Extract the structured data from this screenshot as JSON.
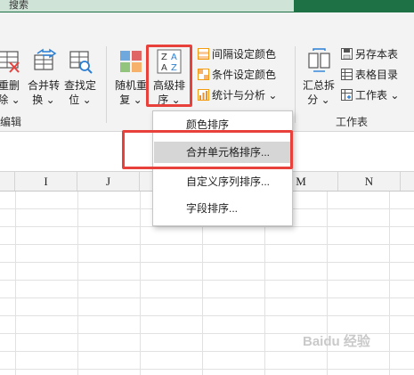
{
  "title_bar": {
    "search_text": "搜索"
  },
  "ribbon": {
    "edit_group": {
      "label": "编辑",
      "buttons": [
        {
          "label_line1": "重删",
          "label_line2": "除 ⌄"
        },
        {
          "label_line1": "合并转",
          "label_line2": "换 ⌄"
        },
        {
          "label_line1": "查找定",
          "label_line2": "位 ⌄"
        }
      ]
    },
    "sort_group": {
      "random_button": {
        "label_line1": "随机重",
        "label_line2": "复 ⌄"
      },
      "advanced_sort_button": {
        "label_line1": "高级排",
        "label_line2": "序 ⌄"
      },
      "sort_icon_glyphs": [
        "Z",
        "A",
        "A",
        "Z"
      ],
      "small_buttons": [
        {
          "label": "间隔设定颜色"
        },
        {
          "label": "条件设定颜色"
        },
        {
          "label": "统计与分析 ⌄"
        }
      ]
    },
    "worksheet_group": {
      "label": "工作表",
      "summary_button": {
        "label_line1": "汇总拆",
        "label_line2": "分 ⌄"
      },
      "small_buttons": [
        {
          "label": "另存本表"
        },
        {
          "label": "表格目录"
        },
        {
          "label": "工作表 ⌄"
        }
      ]
    }
  },
  "dropdown_menu": {
    "items": [
      {
        "label": "颜色排序"
      },
      {
        "label": "合并单元格排序...",
        "highlighted": true
      },
      {
        "label": "自定义序列排序..."
      },
      {
        "label": "字段排序..."
      }
    ]
  },
  "sheet": {
    "columns": [
      "I",
      "J",
      "K",
      "L",
      "M",
      "N"
    ]
  },
  "watermark": {
    "text": "Baidu 经验"
  },
  "colors": {
    "accent_green": "#1e7145",
    "highlight_red": "#e8413c",
    "menu_hover": "#d6d6d6"
  }
}
